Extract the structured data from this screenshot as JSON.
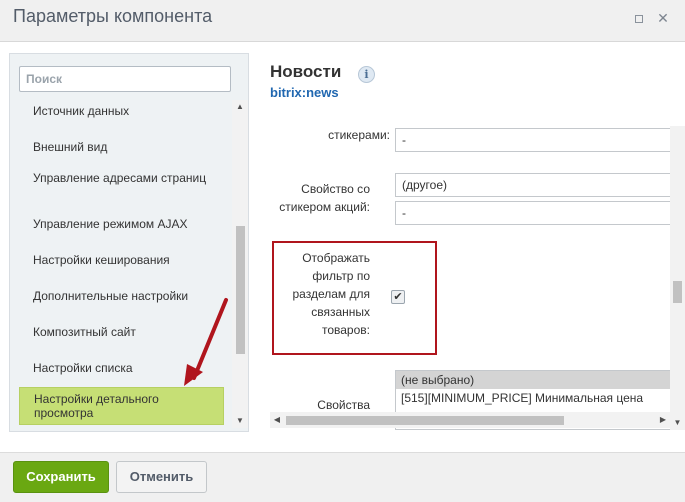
{
  "window": {
    "title": "Параметры компонента",
    "maximize_icon": "maximize-icon",
    "close_icon": "close-icon"
  },
  "sidebar": {
    "search_placeholder": "Поиск",
    "items": [
      {
        "label": "Источник данных"
      },
      {
        "label": "Внешний вид"
      },
      {
        "label": "Управление адресами страниц"
      },
      {
        "label": "Управление режимом AJAX"
      },
      {
        "label": "Настройки кеширования"
      },
      {
        "label": "Дополнительные настройки"
      },
      {
        "label": "Композитный сайт"
      },
      {
        "label": "Настройки списка"
      },
      {
        "label": "Настройки детального просмотра",
        "active": true
      }
    ]
  },
  "component": {
    "title": "Новости",
    "code": "bitrix:news",
    "info_icon": "i"
  },
  "fields": {
    "stickers_label": "стикерами:",
    "stickers_value": "-",
    "promo_label": "Свойство со стикером акций:",
    "promo_value_1": "(другое)",
    "promo_value_2": "-",
    "filter_label": "Отображать фильтр по разделам для связанных товаров:",
    "filter_checked": true,
    "properties_label": "Свойства",
    "properties_options": [
      "(не выбрано)",
      "[515][MINIMUM_PRICE] Минимальная цена"
    ]
  },
  "footer": {
    "save_label": "Сохранить",
    "cancel_label": "Отменить"
  },
  "colors": {
    "accent_green": "#6aa812",
    "active_item": "#c6df75",
    "highlight_red": "#b0151d",
    "link_blue": "#2067b0"
  }
}
